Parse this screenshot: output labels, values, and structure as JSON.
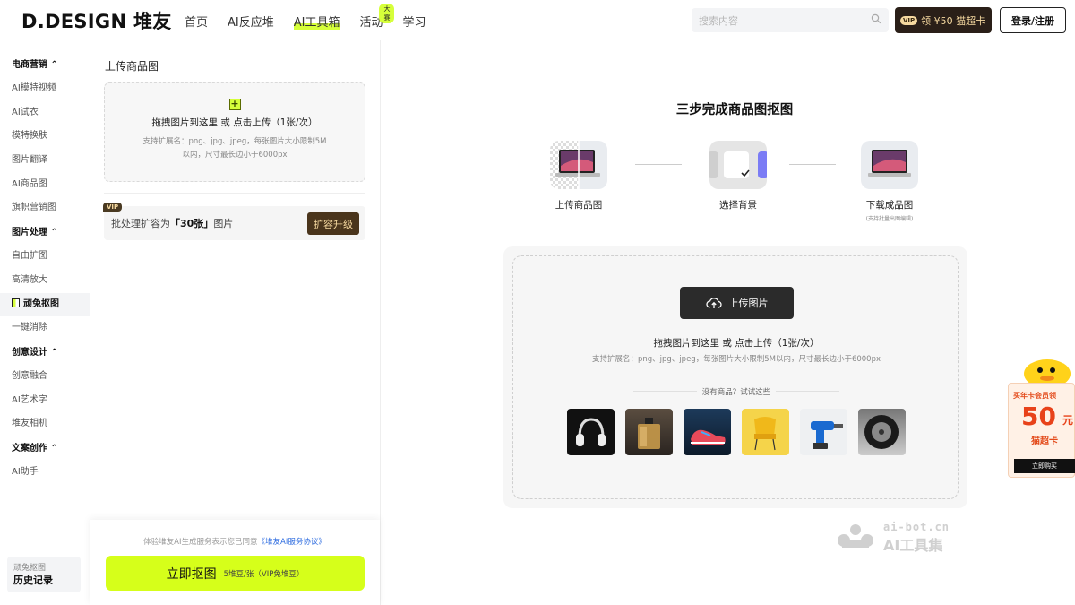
{
  "header": {
    "logo": "D.DESIGN 堆友",
    "nav": [
      {
        "label": "首页"
      },
      {
        "label": "AI反应堆"
      },
      {
        "label": "AI工具箱"
      },
      {
        "label": "活动"
      },
      {
        "label": "学习"
      }
    ],
    "nav_badge": "大赛",
    "search_placeholder": "搜索内容",
    "vip_tag": "VIP",
    "vip_offer": "领 ¥50 猫超卡",
    "login": "登录/注册"
  },
  "sidebar": {
    "groups": [
      {
        "title": "电商营销",
        "items": [
          "AI模特视频",
          "AI试衣",
          "模特换肤",
          "图片翻译",
          "AI商品图",
          "旗帜营销图"
        ]
      },
      {
        "title": "图片处理",
        "items": [
          "自由扩图",
          "高清放大",
          "顽兔抠图",
          "一键消除"
        ]
      },
      {
        "title": "创意设计",
        "items": [
          "创意融合",
          "AI艺术字",
          "堆友相机"
        ]
      },
      {
        "title": "文案创作",
        "items": [
          "AI助手"
        ]
      }
    ],
    "active_item": "顽兔抠图",
    "history_sub": "顽兔抠图",
    "history_title": "历史记录"
  },
  "left_panel": {
    "title": "上传商品图",
    "upload_title": "拖拽图片到这里 或 点击上传（1张/次）",
    "upload_sub1": "支持扩展名：png、jpg、jpeg，每张图片大小限制5M",
    "upload_sub2": "以内，尺寸最长边小于6000px",
    "vip_corner": "VIP",
    "batch_prefix": "批处理扩容为",
    "batch_count": "「30张」",
    "batch_suffix": "图片",
    "expand_btn": "扩容升级",
    "agreement_prefix": "体验堆友AI生成服务表示您已同意",
    "agreement_link": "《堆友AI服务协议》",
    "go_btn": "立即抠图",
    "go_price": "5堆豆/张（VIP免堆豆）"
  },
  "main": {
    "steps_title": "三步完成商品图抠图",
    "steps": [
      {
        "label": "上传商品图",
        "note": ""
      },
      {
        "label": "选择背景",
        "note": ""
      },
      {
        "label": "下载成品图",
        "note": "(支持批量出图编辑)"
      }
    ],
    "upload_btn": "上传图片",
    "drop_title": "拖拽图片到这里 或 点击上传（1张/次）",
    "drop_sub": "支持扩展名：png、jpg、jpeg，每张图片大小限制5M以内，尺寸最长边小于6000px",
    "try_text": "没有商品？试试这些",
    "samples": [
      "headphones",
      "perfume",
      "sneaker",
      "chair",
      "drill",
      "tire"
    ]
  },
  "watermark": {
    "line1": "ai-bot.cn",
    "line2": "AI工具集"
  },
  "promo": {
    "line1": "买年卡会员领",
    "big": "50",
    "unit": "元",
    "card": "猫超卡",
    "buy": "立即购买"
  }
}
